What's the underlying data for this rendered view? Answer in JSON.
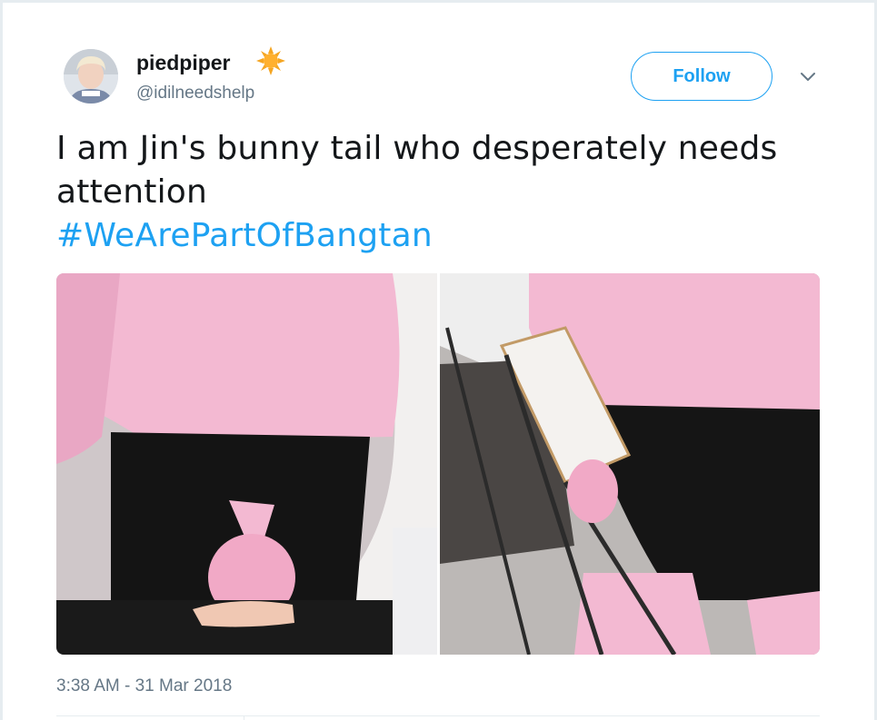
{
  "user": {
    "display_name": "piedpiper",
    "handle": "@idilneedshelp",
    "badge_icon": "sun-emoji-icon",
    "avatar_icon": "profile-photo"
  },
  "header": {
    "follow_label": "Follow",
    "menu_icon": "chevron-down-icon"
  },
  "tweet": {
    "text": "I am Jin's bunny tail who desperately needs attention",
    "hashtag": "#WeArePartOfBangtan",
    "timestamp": "3:38 AM - 31 Mar 2018"
  },
  "media": {
    "count": 2,
    "images": [
      {
        "description_name": "photo-left"
      },
      {
        "description_name": "photo-right"
      }
    ]
  },
  "colors": {
    "accent": "#1da1f2",
    "text": "#14171a",
    "secondary": "#657786"
  }
}
